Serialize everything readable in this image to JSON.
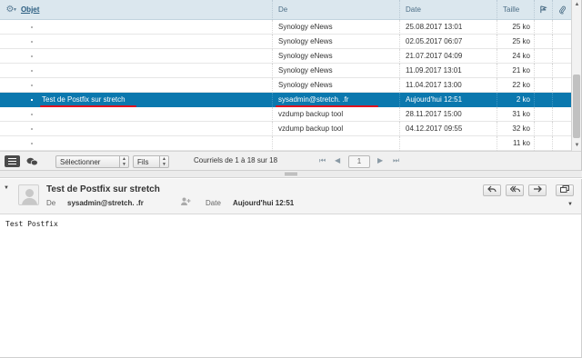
{
  "header": {
    "subject_label": "Objet",
    "from_label": "De",
    "date_label": "Date",
    "size_label": "Taille",
    "gear_icon": "gear-icon",
    "flag_icon": "flag-icon",
    "attachment_icon": "paperclip-icon"
  },
  "messages": [
    {
      "subject": "",
      "from": "Synology eNews",
      "date": "25.08.2017 13:01",
      "size": "25 ko"
    },
    {
      "subject": "",
      "from": "Synology eNews",
      "date": "02.05.2017 06:07",
      "size": "25 ko"
    },
    {
      "subject": "",
      "from": "Synology eNews",
      "date": "21.07.2017 04:09",
      "size": "24 ko"
    },
    {
      "subject": "",
      "from": "Synology eNews",
      "date": "11.09.2017 13:01",
      "size": "21 ko"
    },
    {
      "subject": "",
      "from": "Synology eNews",
      "date": "11.04.2017 13:00",
      "size": "22 ko"
    },
    {
      "subject": "Test de Postfix sur stretch",
      "from": "sysadmin@stretch.          .fr",
      "date": "Aujourd'hui 12:51",
      "size": "2 ko",
      "selected": true
    },
    {
      "subject": "",
      "from": "vzdump backup tool",
      "date": "28.11.2017 15:00",
      "size": "31 ko"
    },
    {
      "subject": "",
      "from": "vzdump backup tool",
      "date": "04.12.2017 09:55",
      "size": "32 ko"
    },
    {
      "subject": "",
      "from": "",
      "date": "",
      "size": "11 ko"
    }
  ],
  "toolbar": {
    "select_label": "Sélectionner",
    "threads_label": "Fils",
    "count_text": "Courriels de 1 à 18 sur 18",
    "page_value": "1",
    "first_icon": "first-page-icon",
    "prev_icon": "prev-page-icon",
    "next_icon": "next-page-icon",
    "last_icon": "last-page-icon"
  },
  "preview": {
    "subject": "Test de Postfix sur stretch",
    "from_label": "De",
    "from_value": "sysadmin@stretch.          .fr",
    "date_label": "Date",
    "date_value": "Aujourd'hui 12:51",
    "body": "Test Postfix"
  },
  "colors": {
    "selected_row": "#0b78ae",
    "header_bg": "#dbe7ee",
    "annotation_red": "#e0101e"
  }
}
